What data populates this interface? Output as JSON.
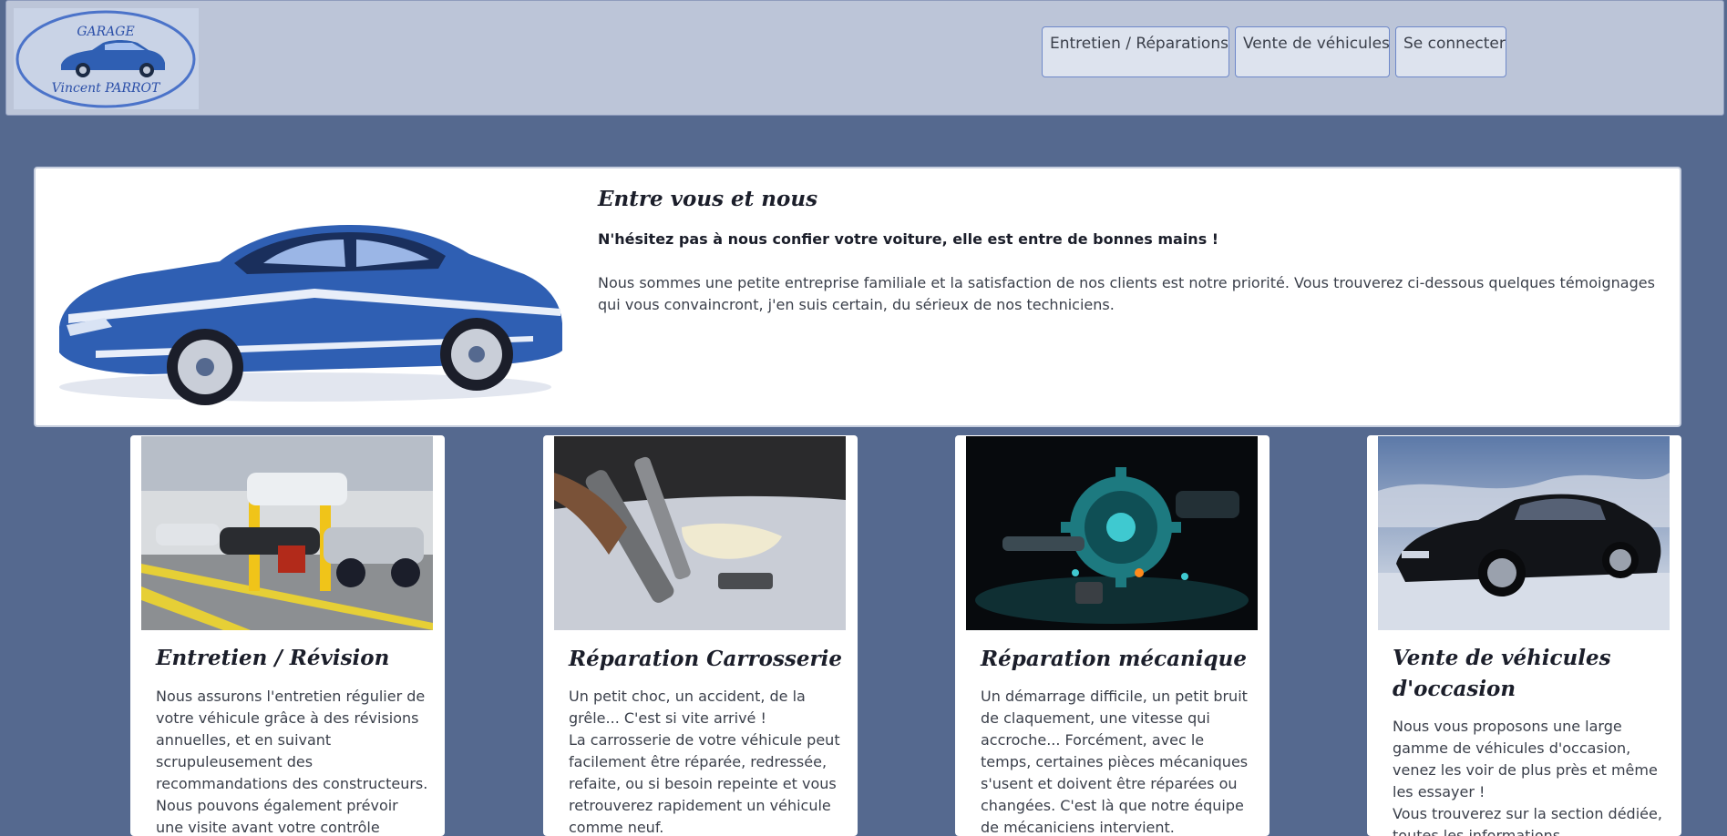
{
  "navbar": {
    "logo": {
      "line1": "GARAGE",
      "line2": "Vincent   PARROT"
    },
    "buttons": [
      {
        "label": "Entretien / Réparations"
      },
      {
        "label": "Vente de véhicules"
      },
      {
        "label": "Se connecter"
      }
    ]
  },
  "hero": {
    "title": "Entre vous et nous",
    "subtitle": "N'hésitez pas à nous confier votre voiture, elle est entre de bonnes mains !",
    "text": "Nous sommes une petite entreprise familiale et la satisfaction de nos clients est notre priorité. Vous trouverez ci-dessous quelques témoignages qui vous convaincront, j'en suis certain, du sérieux de nos techniciens."
  },
  "cards": [
    {
      "title": "Entretien / Révision",
      "text": "Nous assurons l'entretien régulier de votre véhicule grâce à des révisions annuelles, et en suivant scrupuleusement des recommandations des constructeurs. Nous pouvons également prévoir une visite avant votre contrôle technique."
    },
    {
      "title": "Réparation Carrosserie",
      "text": "Un petit choc, un accident, de la grêle... C'est si vite arrivé !\nLa carrosserie de votre véhicule peut facilement être réparée, redressée, refaite, ou si besoin repeinte et vous retrouverez rapidement un véhicule comme neuf."
    },
    {
      "title": "Réparation mécanique",
      "text": "Un démarrage difficile, un petit bruit de claquement, une vitesse qui accroche... Forcément, avec le temps, certaines pièces mécaniques s'usent et doivent être réparées ou changées. C'est là que notre équipe de mécaniciens intervient."
    },
    {
      "title": "Vente de véhicules d'occasion",
      "text": "Nous vous proposons une large gamme de véhicules d'occasion, venez les voir de plus près et même les essayer !\nVous trouverez sur la section dédiée, toutes les informations."
    }
  ],
  "colors": {
    "page_background": "#55698f",
    "navbar_background": "#bcc5d8",
    "button_background": "#dde3ee",
    "button_border": "#6e88c9",
    "car_blue": "#2f5fb3"
  }
}
